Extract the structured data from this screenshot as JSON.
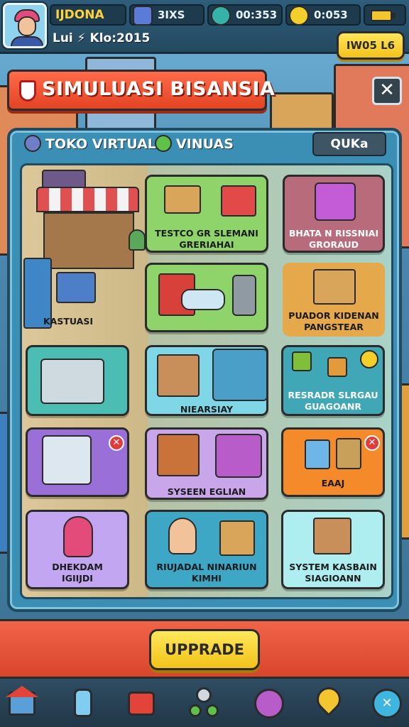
{
  "header": {
    "player_name": "IJDONA",
    "subline": "Lui ⚡ Klo:2015",
    "stats": [
      {
        "icon": "gem-icon",
        "value": "3IXS",
        "color": "#5a7bd8"
      },
      {
        "icon": "clock-coin-icon",
        "value": "00:353",
        "color": "#35b3a8"
      },
      {
        "icon": "gold-coin-icon",
        "value": "0:053",
        "color": "#f2cf2a"
      }
    ],
    "top_button_label": "IW05 L6"
  },
  "title": {
    "text": "SIMULUASI BISANSIA",
    "close_label": "✕"
  },
  "tabs": [
    {
      "label": "TOKO VIRTUAL",
      "color": "#6f7ec9"
    },
    {
      "label": "VINUAS",
      "color": "#5fc04a"
    }
  ],
  "quick_button_label": "QUKa",
  "scene_label": "KASTUASI",
  "tiles": [
    {
      "name": "tile-testco",
      "label": "TESTCO GR SLEMANI\nGRERIAHAI",
      "color": "#8fd46a"
    },
    {
      "name": "tile-bhata",
      "label": "BHATA N RISSNIAI\nGRORAUD",
      "color": "#b86b7a"
    },
    {
      "name": "tile-security-crate",
      "label": "",
      "color": "#8fd46a"
    },
    {
      "name": "tile-puador",
      "label": "PUADOR KIDENAN\nPANGSTEAR",
      "color": "#e5a84a"
    },
    {
      "name": "tile-laptop",
      "label": "",
      "color": "#4bbdb2"
    },
    {
      "name": "tile-niersasiay",
      "label": "NIEARSIAY",
      "color": "#7fd6e6"
    },
    {
      "name": "tile-resradr",
      "label": "RESRADR SLRGAU\nGUAGOANR",
      "color": "#3fa7b6"
    },
    {
      "name": "tile-dashboard",
      "label": "",
      "color": "#9b6fd8"
    },
    {
      "name": "tile-sysen",
      "label": "SYSEEN EGLIAN",
      "color": "#c9a6ea"
    },
    {
      "name": "tile-orange",
      "label": "EAAJ",
      "color": "#f48a2a"
    },
    {
      "name": "tile-dhekdam",
      "label": "DHEKDAM\nIGIIJDI",
      "color": "#c3a6f2"
    },
    {
      "name": "tile-riujadal",
      "label": "RIUJADAL NINARIUN\nKIMHI",
      "color": "#3fa7c6"
    },
    {
      "name": "tile-system",
      "label": "SYSTEM KASBAIN\nSIAGIOANN",
      "color": "#aeeef0"
    }
  ],
  "upgrade_label": "UPPRADE",
  "nav": [
    {
      "icon": "home-icon"
    },
    {
      "icon": "bottle-icon"
    },
    {
      "icon": "gift-box-icon"
    },
    {
      "icon": "network-icon"
    },
    {
      "icon": "compass-icon"
    },
    {
      "icon": "map-pin-icon"
    },
    {
      "icon": "settings-icon"
    }
  ]
}
